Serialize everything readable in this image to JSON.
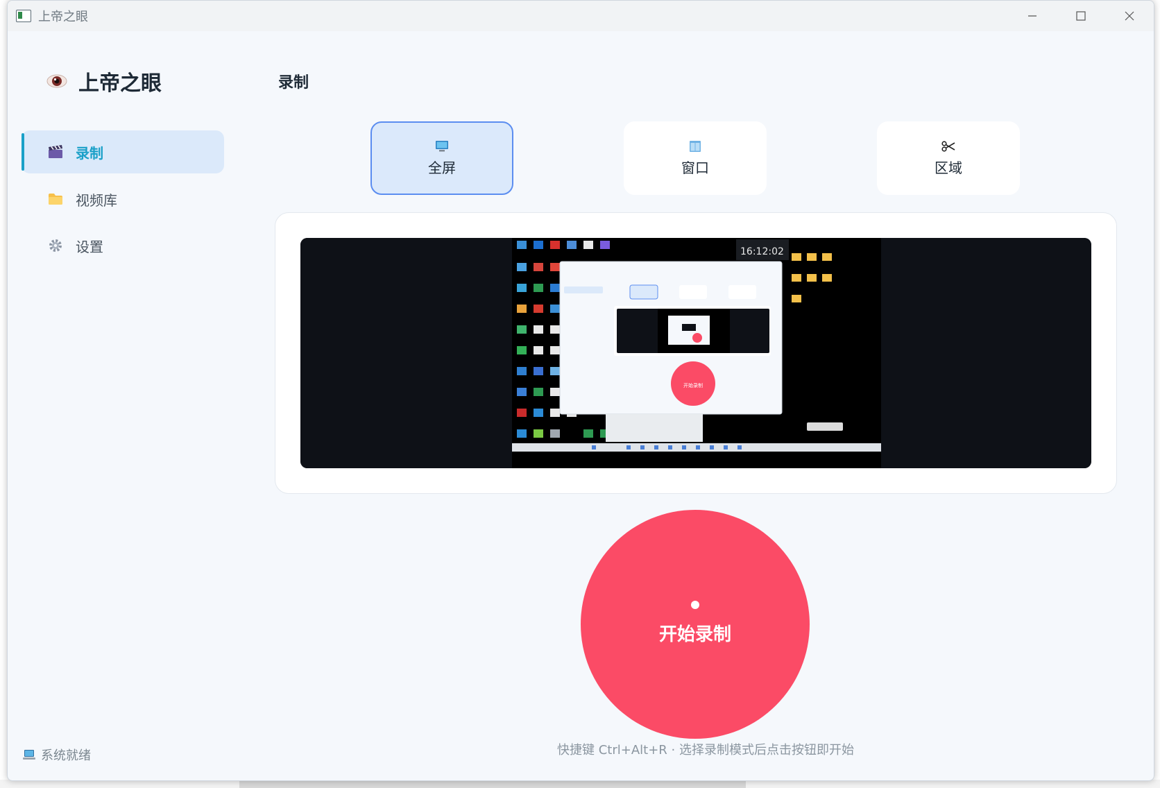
{
  "window": {
    "title": "上帝之眼"
  },
  "sidebar": {
    "app_name": "上帝之眼",
    "items": [
      {
        "label": "录制",
        "icon": "clapperboard-icon",
        "active": true
      },
      {
        "label": "视频库",
        "icon": "folder-icon",
        "active": false
      },
      {
        "label": "设置",
        "icon": "gear-icon",
        "active": false
      }
    ],
    "status": "系统就绪"
  },
  "main": {
    "title": "录制",
    "modes": [
      {
        "label": "全屏",
        "icon": "monitor-icon",
        "selected": true
      },
      {
        "label": "窗口",
        "icon": "window-icon",
        "selected": false
      },
      {
        "label": "区域",
        "icon": "scissors-icon",
        "selected": false
      }
    ],
    "preview": {
      "clock": "16:12:02",
      "nested_button": "开始录制"
    },
    "record_button": "开始录制",
    "hint": "快捷键 Ctrl+Alt+R · 选择录制模式后点击按钮即开始"
  },
  "colors": {
    "accent": "#1aa0c8",
    "selected_border": "#5b8df0",
    "record": "#fb4b66",
    "background": "#f5f8fc"
  }
}
